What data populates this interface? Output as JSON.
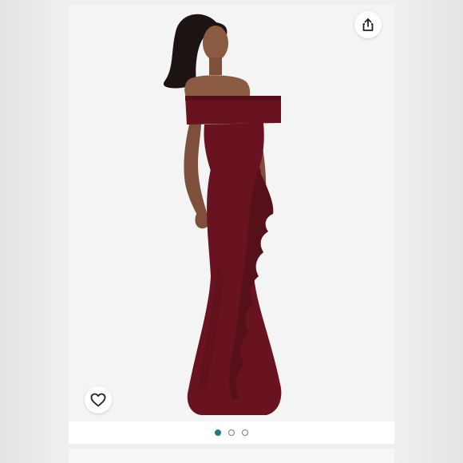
{
  "product_image": {
    "alt": "",
    "dress_color": "#6a1320",
    "background_color": "#f4f4f4"
  },
  "actions": {
    "share_icon": "share-icon",
    "like_icon": "heart-outline-icon"
  },
  "carousel": {
    "total_slides": 3,
    "active_index": 0,
    "active_color": "#1f7a8c"
  }
}
